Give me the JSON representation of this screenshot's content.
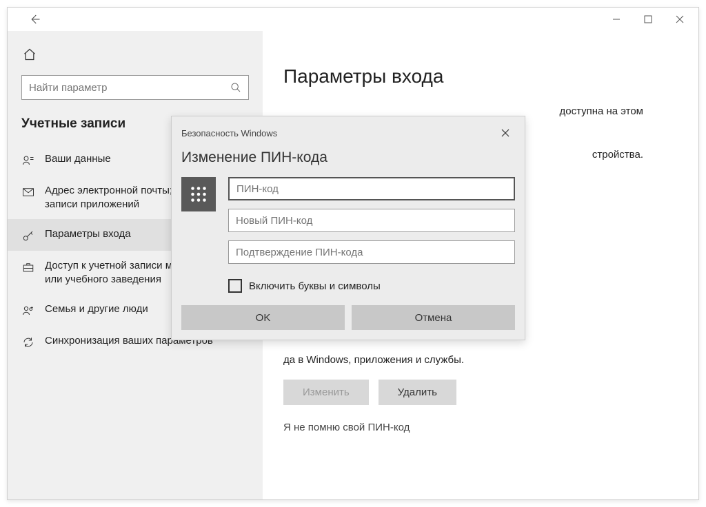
{
  "titlebar": {},
  "sidebar": {
    "search_placeholder": "Найти параметр",
    "section_title": "Учетные записи",
    "items": [
      {
        "label": "Ваши данные"
      },
      {
        "label": "Адрес электронной почты; учетные записи приложений"
      },
      {
        "label": "Параметры входа"
      },
      {
        "label": "Доступ к учетной записи места работы или учебного заведения"
      },
      {
        "label": "Семья и другие люди"
      },
      {
        "label": "Синхронизация ваших параметров"
      }
    ]
  },
  "main": {
    "title": "Параметры входа",
    "line1_tail": "доступна на этом",
    "line2_tail": "стройства.",
    "line3_tail": "да в Windows, приложения и службы.",
    "change_label": "Изменить",
    "delete_label": "Удалить",
    "forgot_label": "Я не помню свой ПИН-код"
  },
  "dialog": {
    "header": "Безопасность Windows",
    "title": "Изменение ПИН-кода",
    "pin_placeholder": "ПИН-код",
    "new_pin_placeholder": "Новый ПИН-код",
    "confirm_pin_placeholder": "Подтверждение ПИН-кода",
    "checkbox_label": "Включить буквы и символы",
    "ok_label": "OK",
    "cancel_label": "Отмена"
  }
}
